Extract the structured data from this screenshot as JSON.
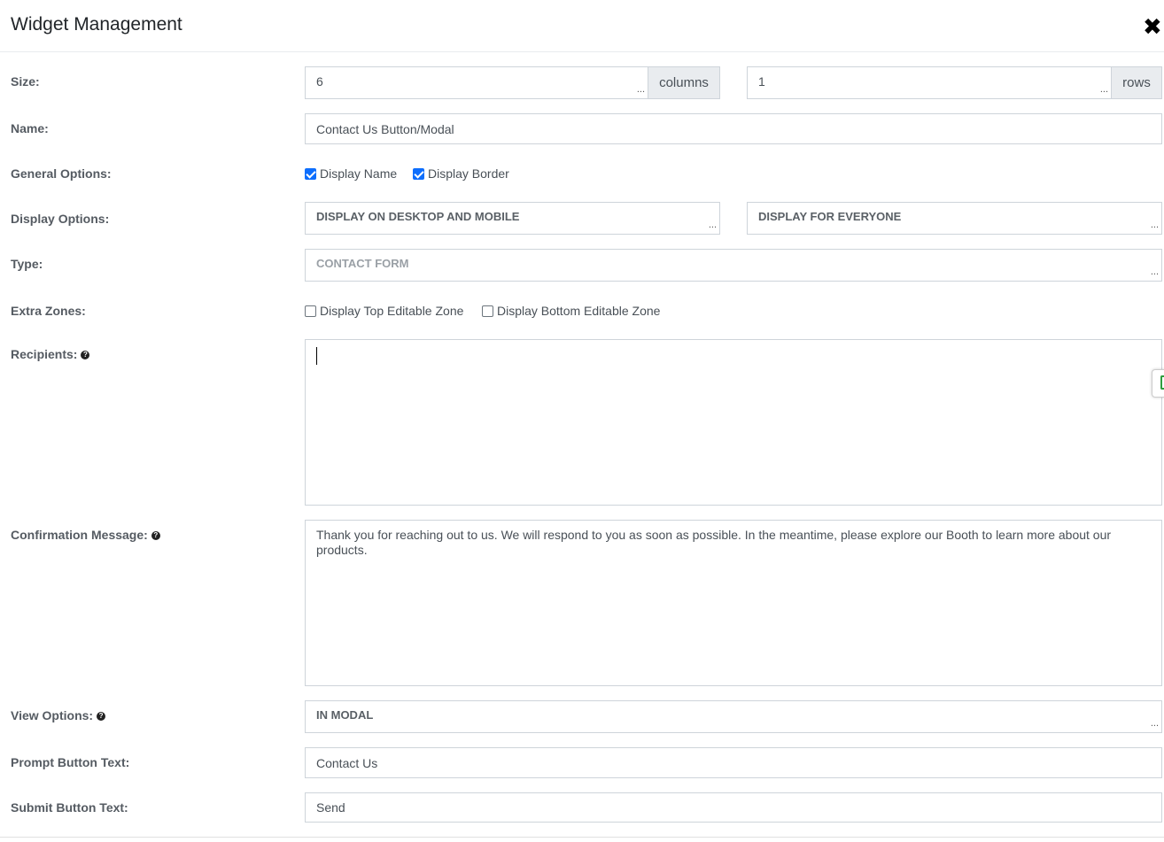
{
  "header": {
    "title": "Widget Management"
  },
  "labels": {
    "size": "Size:",
    "name": "Name:",
    "general_options": "General Options:",
    "display_options": "Display Options:",
    "type": "Type:",
    "extra_zones": "Extra Zones:",
    "recipients": "Recipients:",
    "confirmation_message": "Confirmation Message:",
    "view_options": "View Options:",
    "prompt_button_text": "Prompt Button Text:",
    "submit_button_text": "Submit Button Text:"
  },
  "size": {
    "columns_value": "6",
    "columns_addon": "columns",
    "rows_value": "1",
    "rows_addon": "rows"
  },
  "name_value": "Contact Us Button/Modal",
  "general_options": {
    "display_name": {
      "label": "Display Name",
      "checked": true
    },
    "display_border": {
      "label": "Display Border",
      "checked": true
    }
  },
  "display_options": {
    "device": "DISPLAY ON DESKTOP AND MOBILE",
    "audience": "DISPLAY FOR EVERYONE"
  },
  "type_value": "CONTACT FORM",
  "extra_zones": {
    "top": {
      "label": "Display Top Editable Zone",
      "checked": false
    },
    "bottom": {
      "label": "Display Bottom Editable Zone",
      "checked": false
    }
  },
  "recipients_value": "",
  "confirmation_message_value": "Thank you for reaching out to us. We will respond to you as soon as possible. In the meantime, please explore our Booth to learn more about our products.",
  "view_options_value": "IN MODAL",
  "prompt_button_text_value": "Contact Us",
  "submit_button_text_value": "Send",
  "ellipsis": "...",
  "colors": {
    "checkbox_accent": "#0d6efd",
    "addon_bg": "#e9ecef",
    "border": "#ced4da"
  }
}
